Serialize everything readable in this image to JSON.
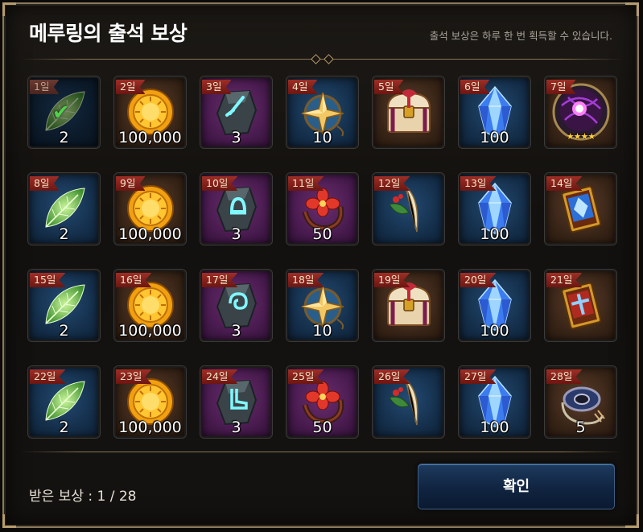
{
  "header": {
    "title": "메루링의 출석 보상",
    "subtitle": "출석 보상은 하루 한 번 획득할 수 있습니다."
  },
  "rewards": [
    {
      "day": "1일",
      "qty": "2",
      "item": "leaf",
      "bg": "blue",
      "claimed": true
    },
    {
      "day": "2일",
      "qty": "100,000",
      "item": "gold-coin",
      "bg": "brown"
    },
    {
      "day": "3일",
      "qty": "3",
      "item": "rune-stone-sword",
      "bg": "purple"
    },
    {
      "day": "4일",
      "qty": "10",
      "item": "star-compass",
      "bg": "blue"
    },
    {
      "day": "5일",
      "qty": "",
      "item": "treasure-chest",
      "bg": "brown"
    },
    {
      "day": "6일",
      "qty": "100",
      "item": "blue-crystal",
      "bg": "blue"
    },
    {
      "day": "7일",
      "qty": "",
      "item": "purple-orb-portrait",
      "bg": "brown",
      "stars": "★★★★"
    },
    {
      "day": "8일",
      "qty": "2",
      "item": "leaf",
      "bg": "blue"
    },
    {
      "day": "9일",
      "qty": "100,000",
      "item": "gold-coin",
      "bg": "brown"
    },
    {
      "day": "10일",
      "qty": "3",
      "item": "rune-stone-bell",
      "bg": "purple"
    },
    {
      "day": "11일",
      "qty": "50",
      "item": "red-flower-ring",
      "bg": "purple"
    },
    {
      "day": "12일",
      "qty": "",
      "item": "feather-herb",
      "bg": "blue"
    },
    {
      "day": "13일",
      "qty": "100",
      "item": "blue-crystal",
      "bg": "blue"
    },
    {
      "day": "14일",
      "qty": "",
      "item": "card-blue",
      "bg": "brown"
    },
    {
      "day": "15일",
      "qty": "2",
      "item": "leaf",
      "bg": "blue"
    },
    {
      "day": "16일",
      "qty": "100,000",
      "item": "gold-coin",
      "bg": "brown"
    },
    {
      "day": "17일",
      "qty": "3",
      "item": "rune-stone-swirl",
      "bg": "purple"
    },
    {
      "day": "18일",
      "qty": "10",
      "item": "star-compass",
      "bg": "blue"
    },
    {
      "day": "19일",
      "qty": "",
      "item": "treasure-chest",
      "bg": "brown"
    },
    {
      "day": "20일",
      "qty": "100",
      "item": "blue-crystal",
      "bg": "blue"
    },
    {
      "day": "21일",
      "qty": "",
      "item": "card-red",
      "bg": "brown"
    },
    {
      "day": "22일",
      "qty": "2",
      "item": "leaf",
      "bg": "blue"
    },
    {
      "day": "23일",
      "qty": "100,000",
      "item": "gold-coin",
      "bg": "brown"
    },
    {
      "day": "24일",
      "qty": "3",
      "item": "rune-stone-boot",
      "bg": "purple"
    },
    {
      "day": "25일",
      "qty": "50",
      "item": "red-flower-ring",
      "bg": "purple"
    },
    {
      "day": "26일",
      "qty": "",
      "item": "feather-herb",
      "bg": "blue"
    },
    {
      "day": "27일",
      "qty": "100",
      "item": "blue-crystal",
      "bg": "blue"
    },
    {
      "day": "28일",
      "qty": "5",
      "item": "rope-medallion",
      "bg": "brown"
    }
  ],
  "footer": {
    "received_label": "받은 보상 : 1 / 28",
    "confirm_label": "확인"
  },
  "colors": {
    "ribbon": "#8e241d",
    "accent_gold": "#b59c6e",
    "button_blue": "#12294a"
  }
}
